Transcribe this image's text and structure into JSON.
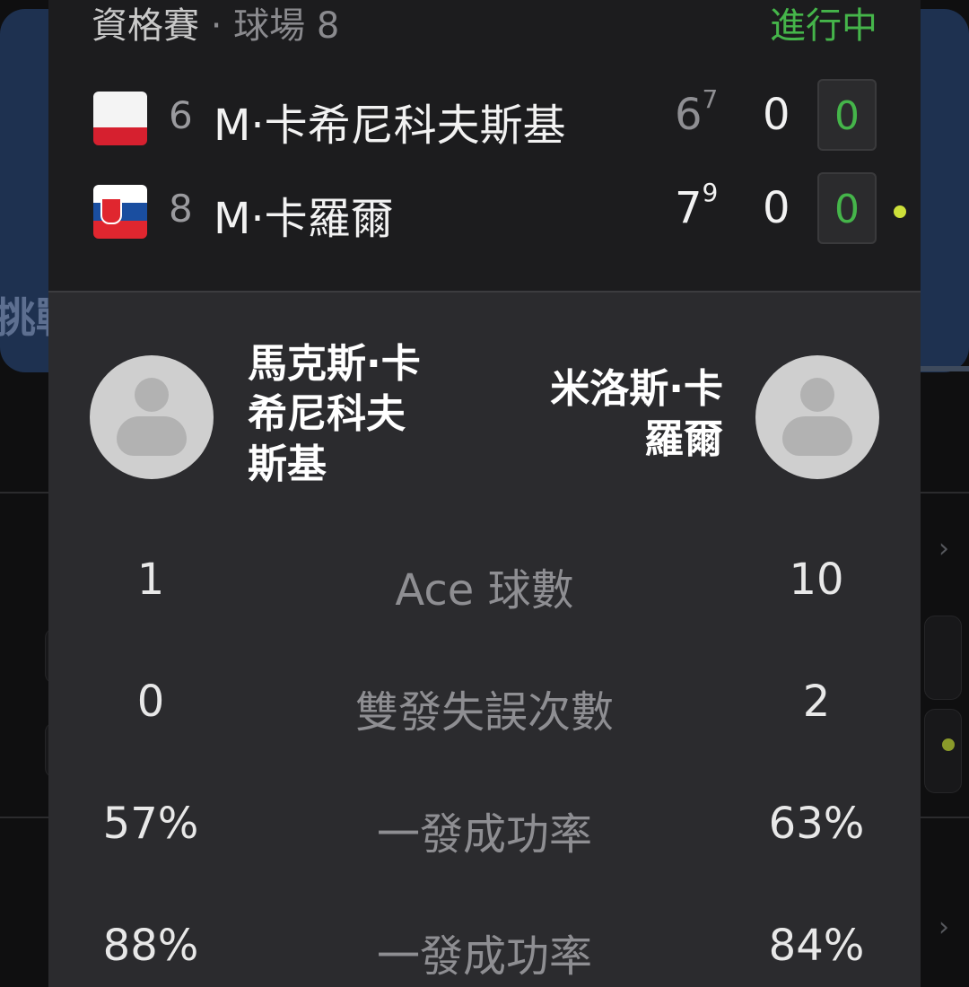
{
  "match": {
    "round": "資格賽",
    "separator": "·",
    "court": "球場 8",
    "status": "進行中"
  },
  "players": [
    {
      "seed": "6",
      "short_name": "M·卡希尼科夫斯基",
      "full_name": "馬克斯·卡希尼科夫斯基",
      "full_name_lines": [
        "馬克斯·卡",
        "希尼科夫",
        "斯基"
      ],
      "set1": "6",
      "set1_tiebreak": "7",
      "set2": "0",
      "game": "0",
      "flag": [
        "#f4f4f4",
        "#f4f4f4",
        "#d6202f"
      ],
      "flag_icon": "poland-flag-icon",
      "serving": false
    },
    {
      "seed": "8",
      "short_name": "M·卡羅爾",
      "full_name": "米洛斯·卡羅爾",
      "full_name_lines": [
        "米洛斯·卡",
        "羅爾"
      ],
      "set1": "7",
      "set1_tiebreak": "9",
      "set2": "0",
      "game": "0",
      "flag": [
        "#ffffff",
        "#1a4ea0",
        "#e0262f"
      ],
      "flag_icon": "slovakia-flag-icon",
      "serving": true
    }
  ],
  "stats": [
    {
      "label": "Ace 球數",
      "p1": "1",
      "p2": "10"
    },
    {
      "label": "雙發失誤次數",
      "p1": "0",
      "p2": "2"
    },
    {
      "label": "一發成功率",
      "p1": "57%",
      "p2": "63%"
    },
    {
      "label": "一發成功率",
      "p1": "88%",
      "p2": "84%"
    }
  ],
  "background": {
    "banner_text": "挑戰"
  },
  "colors": {
    "live_green": "#45b54a",
    "serve_dot": "#cde03a"
  }
}
